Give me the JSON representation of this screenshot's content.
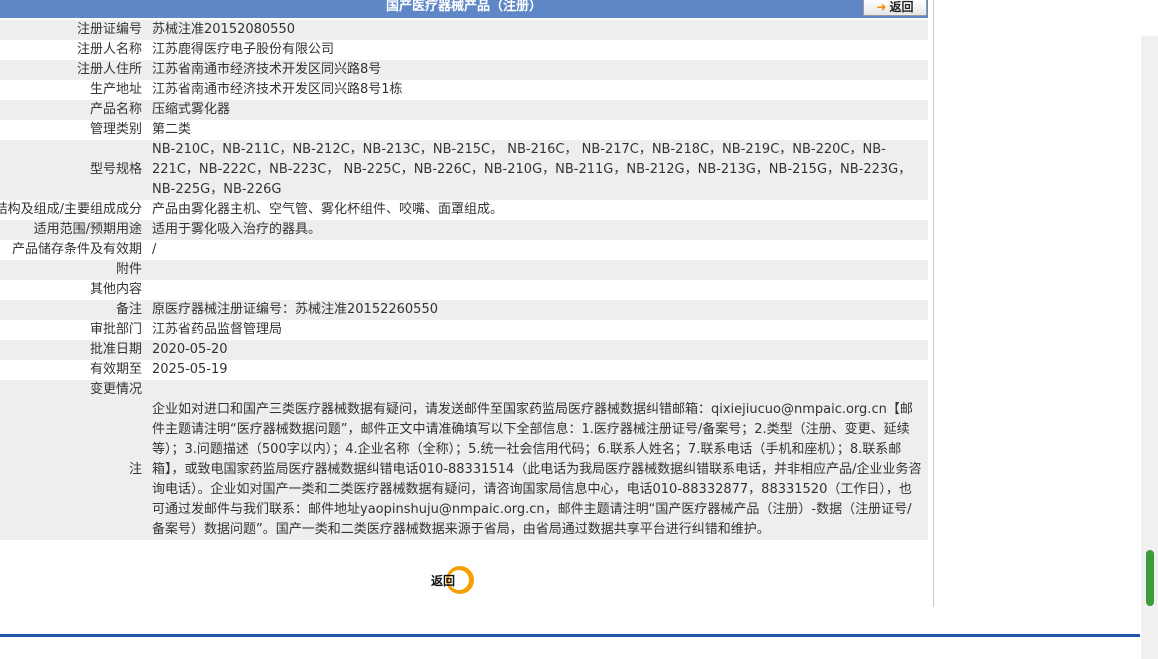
{
  "header": {
    "title": "国产医疗器械产品（注册）",
    "back_label": "返回"
  },
  "fields": [
    {
      "label": "注册证编号",
      "value": "苏械注准20152080550"
    },
    {
      "label": "注册人名称",
      "value": "江苏鹿得医疗电子股份有限公司"
    },
    {
      "label": "注册人住所",
      "value": "江苏省南通市经济技术开发区同兴路8号"
    },
    {
      "label": "生产地址",
      "value": "江苏省南通市经济技术开发区同兴路8号1栋"
    },
    {
      "label": "产品名称",
      "value": "压缩式雾化器"
    },
    {
      "label": "管理类别",
      "value": "第二类"
    },
    {
      "label": "型号规格",
      "value": "NB-210C，NB-211C，NB-212C，NB-213C，NB-215C， NB-216C， NB-217C，NB-218C，NB-219C，NB-220C，NB-221C，NB-222C，NB-223C， NB-225C，NB-226C，NB-210G，NB-211G，NB-212G，NB-213G，NB-215G，NB-223G，NB-225G，NB-226G"
    },
    {
      "label": "结构及组成/主要组成成分",
      "value": "产品由雾化器主机、空气管、雾化杯组件、咬嘴、面罩组成。"
    },
    {
      "label": "适用范围/预期用途",
      "value": "适用于雾化吸入治疗的器具。"
    },
    {
      "label": "产品储存条件及有效期",
      "value": "/"
    },
    {
      "label": "附件",
      "value": ""
    },
    {
      "label": "其他内容",
      "value": ""
    },
    {
      "label": "备注",
      "value": "原医疗器械注册证编号：苏械注准20152260550"
    },
    {
      "label": "审批部门",
      "value": "江苏省药品监督管理局"
    },
    {
      "label": "批准日期",
      "value": "2020-05-20"
    },
    {
      "label": "有效期至",
      "value": "2025-05-19"
    },
    {
      "label": "变更情况",
      "value": ""
    }
  ],
  "note": {
    "label": "注",
    "text": "企业如对进口和国产三类医疗器械数据有疑问，请发送邮件至国家药监局医疗器械数据纠错邮箱：qixiejiucuo@nmpaic.org.cn【邮件主题请注明“医疗器械数据问题”，邮件正文中请准确填写以下全部信息：1.医疗器械注册证号/备案号；2.类型（注册、变更、延续等）；3.问题描述（500字以内）；4.企业名称（全称）；5.统一社会信用代码；6.联系人姓名；7.联系电话（手机和座机）；8.联系邮箱】，或致电国家药监局医疗器械数据纠错电话010-88331514（此电话为我局医疗器械数据纠错联系电话，并非相应产品/企业业务咨询电话）。企业如对国产一类和二类医疗器械数据有疑问，请咨询国家局信息中心，电话010-88332877，88331520（工作日），也可通过发邮件与我们联系：邮件地址yaopinshuju@nmpaic.org.cn，邮件主题请注明“国产医疗器械产品（注册）-数据（注册证号/备案号）数据问题”。国产一类和二类医疗器械数据来源于省局，由省局通过数据共享平台进行纠错和维护。"
  },
  "footer": {
    "back_label": "返回"
  },
  "colors": {
    "title_bg": "#5f87c7",
    "row_alt_bg": "#eeeeee",
    "accent_orange": "#f5a000",
    "divider_blue": "#1f55a8"
  }
}
